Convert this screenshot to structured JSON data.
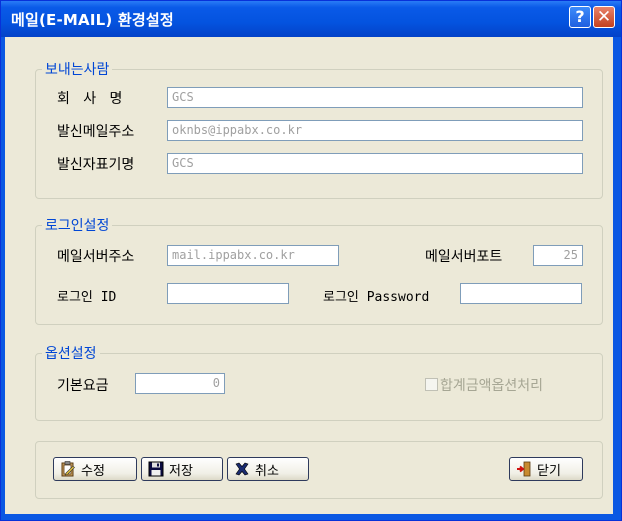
{
  "window": {
    "title": "메일(E-MAIL) 환경설정",
    "help_symbol": "?",
    "close_symbol": "✕"
  },
  "sender": {
    "group_title": "보내는사람",
    "company_label": "회   사   명",
    "company_value": "GCS",
    "email_label": "발신메일주소",
    "email_value": "oknbs@ippabx.co.kr",
    "display_label": "발신자표기명",
    "display_value": "GCS"
  },
  "login": {
    "group_title": "로그인설정",
    "server_label": "메일서버주소",
    "server_value": "mail.ippabx.co.kr",
    "port_label": "메일서버포트",
    "port_value": "25",
    "id_label": "로그인 ID",
    "id_value": "",
    "password_label": "로그인 Password",
    "password_value": ""
  },
  "options": {
    "group_title": "옵션설정",
    "base_fee_label": "기본요금",
    "base_fee_value": "0",
    "total_option_label": "합계금액옵션처리",
    "total_option_checked": false
  },
  "buttons": {
    "edit": "수정",
    "save": "저장",
    "cancel": "취소",
    "close": "닫기"
  },
  "icons": {
    "edit": "clipboard-edit-icon",
    "save": "floppy-disk-icon",
    "cancel": "x-mark-icon",
    "close": "door-exit-icon"
  }
}
